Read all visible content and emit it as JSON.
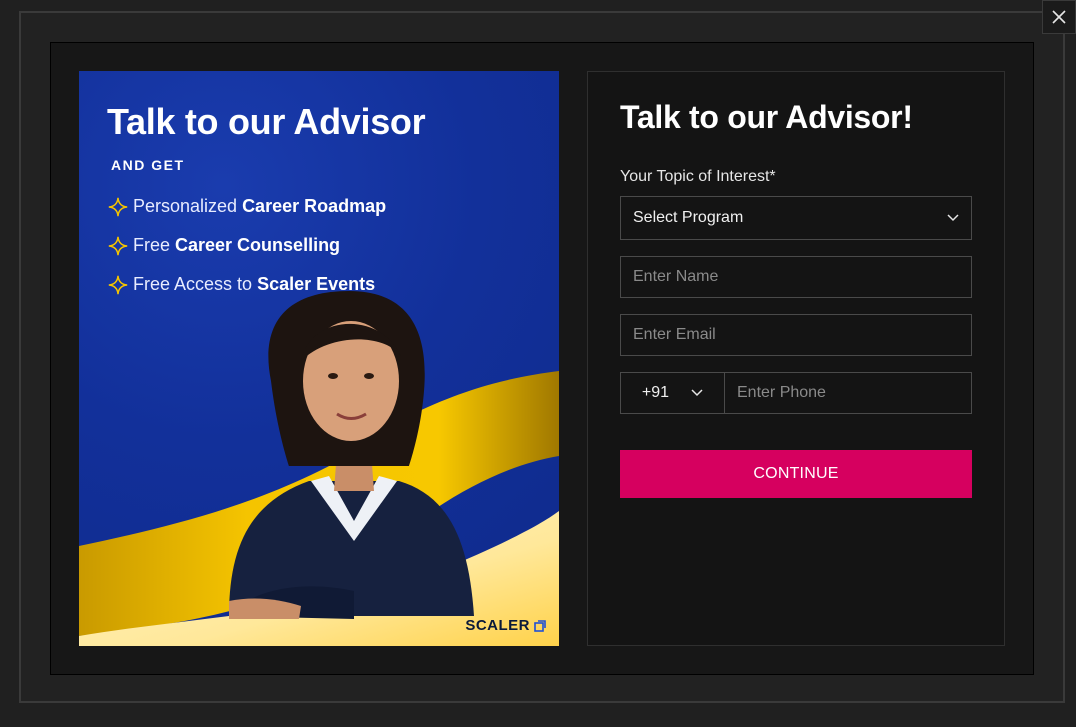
{
  "banner": {
    "title": "Talk to our Advisor",
    "subtitle": "AND GET",
    "benefits": [
      {
        "prefix": "Personalized",
        "highlight": "Career Roadmap"
      },
      {
        "prefix": "Free",
        "highlight": "Career Counselling"
      },
      {
        "prefix": "Free Access to",
        "highlight": "Scaler Events"
      }
    ],
    "logo_text": "SCALER",
    "colors": {
      "background": "#13339c",
      "accent_wave": "#f5c400",
      "star": "#f5c400"
    }
  },
  "form": {
    "title": "Talk to our Advisor!",
    "topic_label": "Your Topic of Interest*",
    "program_select": "Select Program",
    "name_placeholder": "Enter Name",
    "email_placeholder": "Enter Email",
    "country_code": "+91",
    "phone_placeholder": "Enter Phone",
    "continue_label": "CONTINUE",
    "colors": {
      "button": "#d6005f"
    }
  },
  "icons": {
    "close": "close-icon",
    "dropdown": "chevron-down-icon",
    "benefit": "sparkle-icon",
    "logo": "scaler-logo-icon"
  }
}
